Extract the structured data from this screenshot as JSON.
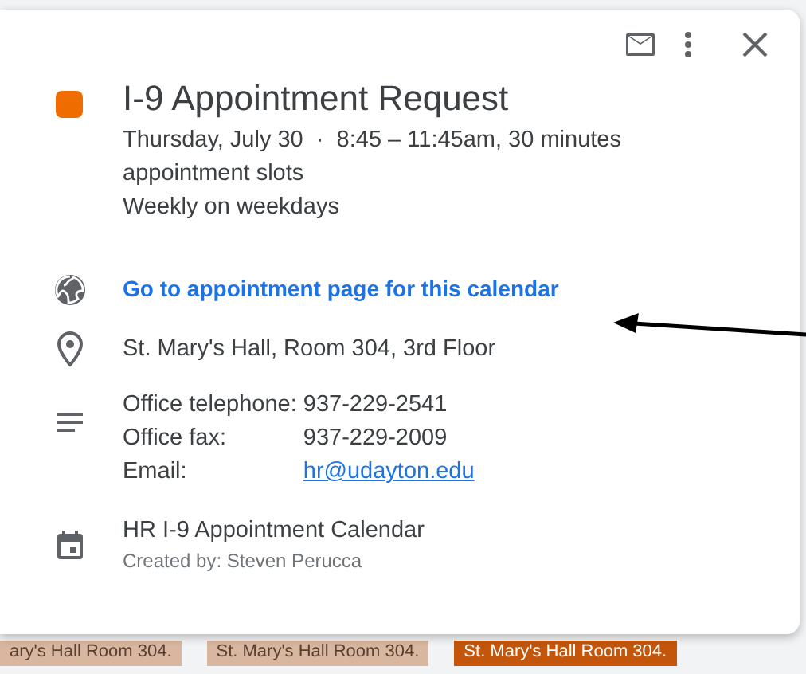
{
  "event": {
    "color": "#ef6c00",
    "title": "I-9 Appointment Request",
    "when": "Thursday, July 30  ·  8:45 – 11:45am, 30 minutes appointment slots",
    "recurrence": "Weekly on weekdays"
  },
  "booking_link": "Go to appointment page for this calendar",
  "location": "St. Mary's Hall, Room 304, 3rd Floor",
  "description": [
    {
      "label": "Office telephone:",
      "value": "937-229-2541",
      "kind": "text"
    },
    {
      "label": "Office fax:",
      "value": "937-229-2009",
      "kind": "text"
    },
    {
      "label": "Email:",
      "value": "hr@udayton.edu",
      "kind": "link"
    }
  ],
  "calendar": {
    "name": "HR I-9 Appointment Calendar",
    "creator": "Created by: Steven Perucca"
  },
  "background_events": [
    {
      "text": "ary's Hall Room 304.",
      "color": "#d8b6a0"
    },
    {
      "text": "St. Mary's Hall Room 304.",
      "color": "#d8b6a0"
    },
    {
      "text": "St. Mary's Hall Room 304.",
      "color": "#c4560c"
    }
  ]
}
